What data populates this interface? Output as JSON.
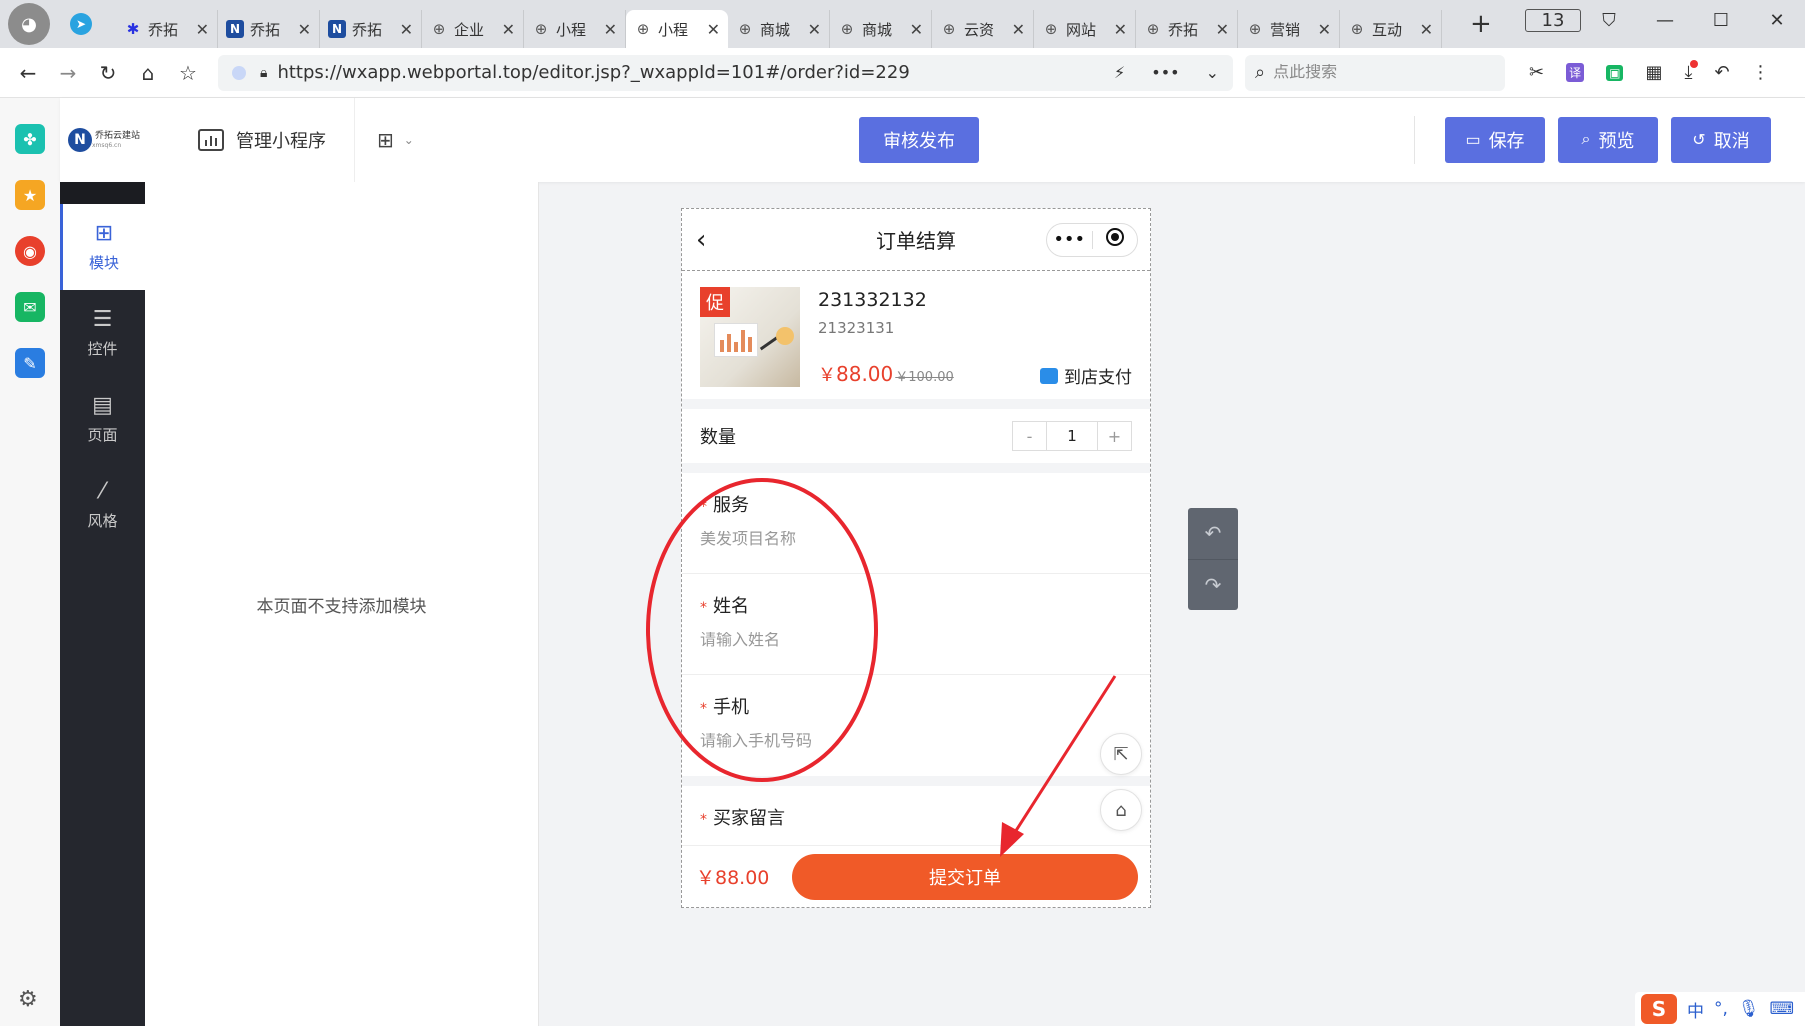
{
  "browser": {
    "tabs": [
      {
        "label": "乔拓",
        "icon": "baidu-paw-icon"
      },
      {
        "label": "乔拓",
        "icon": "n-logo-icon"
      },
      {
        "label": "乔拓",
        "icon": "n-logo-icon"
      },
      {
        "label": "企业",
        "icon": "globe-icon"
      },
      {
        "label": "小程",
        "icon": "globe-icon"
      },
      {
        "label": "小程",
        "icon": "globe-icon",
        "active": true
      },
      {
        "label": "商城",
        "icon": "globe-icon"
      },
      {
        "label": "商城",
        "icon": "globe-icon"
      },
      {
        "label": "云资",
        "icon": "globe-icon"
      },
      {
        "label": "网站",
        "icon": "globe-icon"
      },
      {
        "label": "乔拓",
        "icon": "globe-icon"
      },
      {
        "label": "营销",
        "icon": "globe-icon"
      },
      {
        "label": "互动",
        "icon": "globe-icon"
      }
    ],
    "tab_count": "13",
    "url": "https://wxapp.webportal.top/editor.jsp?_wxappId=101#/order?id=229",
    "search_placeholder": "点此搜索",
    "translate_label": "译"
  },
  "app": {
    "logo_text": "乔拓云建站",
    "logo_sub": "xmsq6.cn",
    "manage_label": "管理小程序",
    "publish_label": "审核发布",
    "save_label": "保存",
    "preview_label": "预览",
    "cancel_label": "取消",
    "sidebar": [
      {
        "label": "模块",
        "icon": "plus-square-icon"
      },
      {
        "label": "控件",
        "icon": "sliders-icon"
      },
      {
        "label": "页面",
        "icon": "page-layout-icon"
      },
      {
        "label": "风格",
        "icon": "magic-wand-icon"
      }
    ],
    "module_panel_message": "本页面不支持添加模块"
  },
  "phone": {
    "title": "订单结算",
    "product": {
      "badge": "促",
      "name": "231332132",
      "subtitle": "21323131",
      "price_symbol": "￥",
      "price": "88.00",
      "original_price": "￥100.00",
      "pay_method": "到店支付"
    },
    "quantity": {
      "label": "数量",
      "minus": "-",
      "value": "1",
      "plus": "+"
    },
    "fields": [
      {
        "label": "服务",
        "placeholder": "美发项目名称"
      },
      {
        "label": "姓名",
        "placeholder": "请输入姓名"
      },
      {
        "label": "手机",
        "placeholder": "请输入手机号码"
      }
    ],
    "next_field_label": "买家留言",
    "total": "￥88.00",
    "submit_label": "提交订单"
  },
  "ime": {
    "mode": "中",
    "punct": "°,"
  },
  "colors": {
    "accent": "#5a6fe0",
    "price_red": "#e8402c",
    "submit_orange": "#f05a28",
    "annotation_red": "#e8262e"
  }
}
